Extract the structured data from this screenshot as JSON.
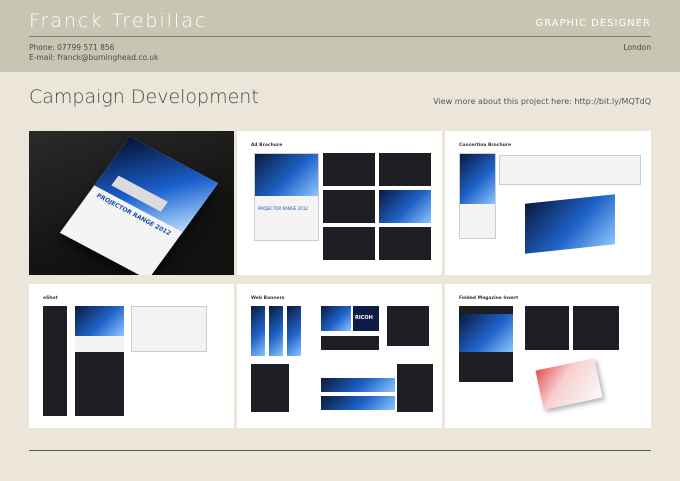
{
  "header": {
    "name": "Franck Trebillac",
    "role": "GRAPHIC DESIGNER",
    "phone": "Phone: 07799 571 856",
    "email": "E-mail: franck@burninghead.co.uk",
    "location": "London"
  },
  "section": {
    "title": "Campaign Development",
    "link_text": "View more about this project here: http://bit.ly/MQTdQ"
  },
  "cards": [
    {
      "label": ""
    },
    {
      "label": "A4 Brochure"
    },
    {
      "label": "Concertina Brochure"
    },
    {
      "label": "eShot"
    },
    {
      "label": "Web Banners"
    },
    {
      "label": "Folded Magazine Insert"
    }
  ],
  "artwork": {
    "brochure_cover_text": "PROJECTOR RANGE 2012",
    "banner_logo_text": "RICOH"
  }
}
